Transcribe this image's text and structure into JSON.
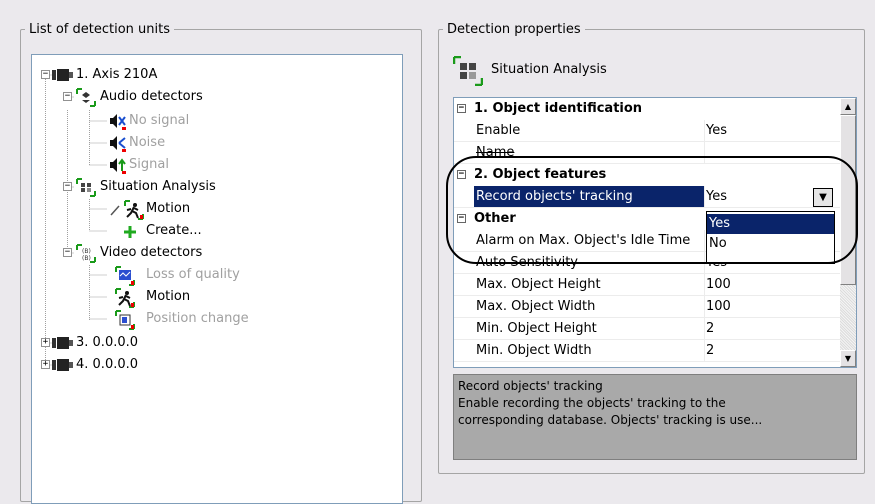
{
  "left_panel": {
    "legend": "List of detection units"
  },
  "right_panel": {
    "legend": "Detection properties",
    "header_title": "Situation Analysis"
  },
  "tree": {
    "axis": "1. Axis 210A",
    "audio": "Audio detectors",
    "no_signal": "No signal",
    "noise": "Noise",
    "signal": "Signal",
    "situation": "Situation Analysis",
    "sit_motion": "Motion",
    "create": "Create...",
    "video": "Video detectors",
    "loss": "Loss of quality",
    "vid_motion": "Motion",
    "position": "Position change",
    "dev3": "3. 0.0.0.0",
    "dev4": "4. 0.0.0.0"
  },
  "grid": {
    "cat1": "1. Object identification",
    "enable_name": "Enable",
    "enable_value": "Yes",
    "name_name": "Name",
    "name_value": "",
    "cat2": "2. Object features",
    "record_name": "Record objects' tracking",
    "record_value": "Yes",
    "cat3": "Other",
    "alarm_name": "Alarm on Max. Object's Idle Time",
    "alarm_value": "",
    "auto_name": "Auto Sensitivity",
    "auto_value": "Yes",
    "maxh_name": "Max. Object Height",
    "maxh_value": "100",
    "maxw_name": "Max. Object Width",
    "maxw_value": "100",
    "minh_name": "Min. Object Height",
    "minh_value": "2",
    "minw_name": "Min. Object Width",
    "minw_value": "2"
  },
  "dropdown": {
    "options": [
      "Yes",
      "No"
    ],
    "selected": "Yes"
  },
  "description": {
    "title": "Record objects' tracking",
    "line1": "Enable recording the objects' tracking to the",
    "line2": "corresponding database. Objects' tracking is use..."
  },
  "colors": {
    "selection": "#0a246a",
    "description_bg": "#a9a9a9",
    "window_bg": "#ebe9ed"
  },
  "icons": {
    "camera": "camera-icon",
    "audio": "audio-detector-icon",
    "speaker": "speaker-icon",
    "situation": "situation-analysis-icon",
    "motion": "motion-runner-icon",
    "create": "green-plus-icon",
    "video": "video-detector-icon"
  }
}
